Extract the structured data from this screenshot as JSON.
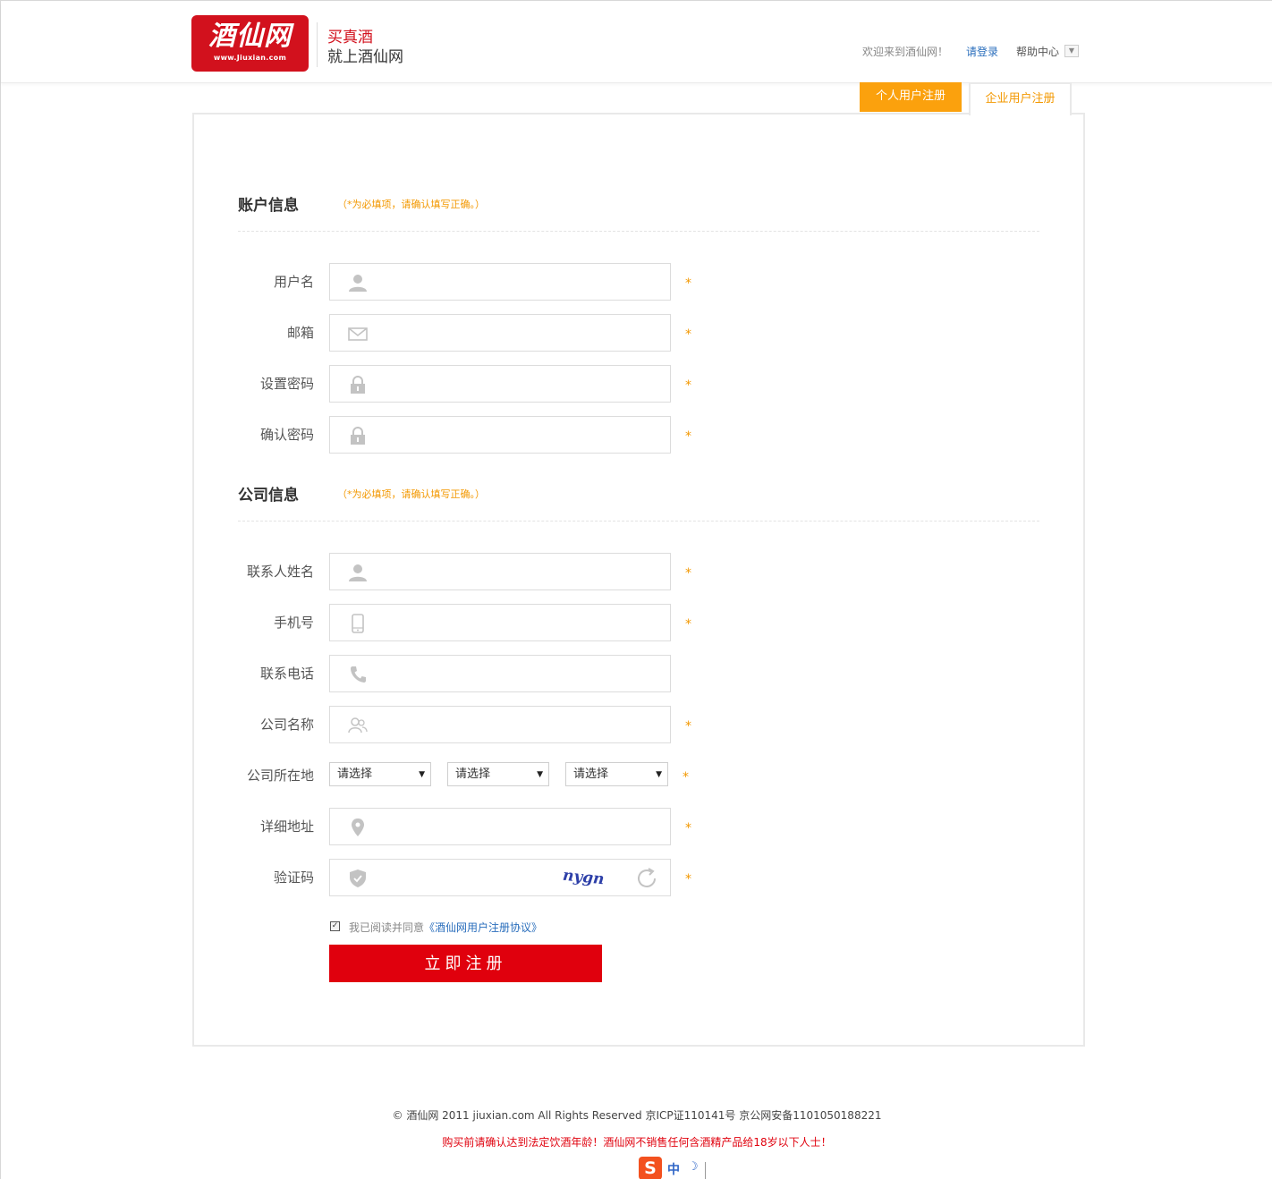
{
  "header": {
    "logo_text": "酒仙网",
    "logo_sub": "www.Jiuxian.com",
    "slogan_line1": "买真酒",
    "slogan_line2": "就上酒仙网",
    "welcome": "欢迎来到酒仙网！",
    "login": "请登录",
    "help": "帮助中心"
  },
  "tabs": {
    "personal": "个人用户注册",
    "enterprise": "企业用户注册"
  },
  "account_section": {
    "title": "账户信息",
    "note": "（*为必填项，请确认填写正确。）",
    "fields": {
      "username": "用户名",
      "email": "邮箱",
      "password": "设置密码",
      "confirm": "确认密码"
    }
  },
  "company_section": {
    "title": "公司信息",
    "note": "（*为必填项，请确认填写正确。）",
    "fields": {
      "contact": "联系人姓名",
      "mobile": "手机号",
      "phone": "联系电话",
      "company": "公司名称",
      "location": "公司所在地",
      "address": "详细地址",
      "captcha": "验证码"
    },
    "selects": [
      "请选择",
      "请选择",
      "请选择"
    ]
  },
  "required_mark": "*",
  "captcha_text": "nygn",
  "agreement": {
    "prefix": "我已阅读并同意",
    "link": "《酒仙网用户注册协议》",
    "checked": true
  },
  "submit": "立即注册",
  "footer": {
    "line1": "© 酒仙网 2011 jiuxian.com All Rights Reserved 京ICP证110141号 京公网安备1101050188221",
    "line2": "购买前请确认达到法定饮酒年龄！酒仙网不销售任何含酒精产品给18岁以下人士！"
  },
  "ime": {
    "logo": "S",
    "mode": "中",
    "moon": "☽"
  },
  "colors": {
    "brand_red": "#d2111d",
    "accent_orange": "#fba10d",
    "link_blue": "#2a6ebc",
    "submit_red": "#e0000d"
  }
}
